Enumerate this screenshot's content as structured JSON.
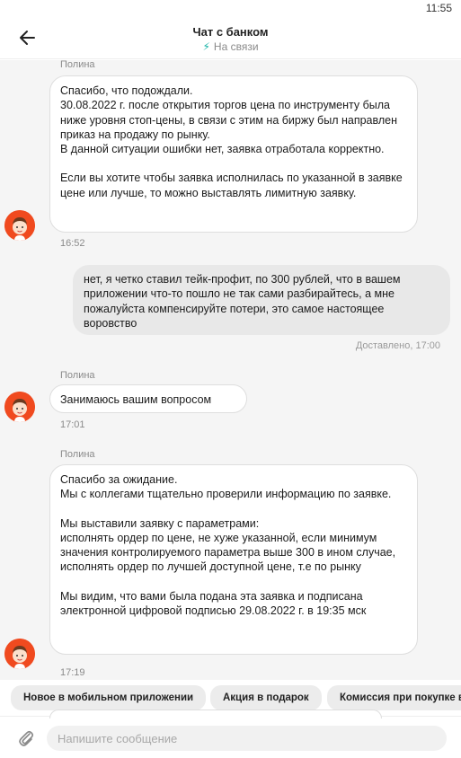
{
  "status_bar": {
    "time": "11:55"
  },
  "header": {
    "title": "Чат с банком",
    "status": "На связи",
    "status_color": "#16b3a6"
  },
  "messages": [
    {
      "direction": "incoming",
      "sender": "Полина",
      "paragraphs": [
        "Спасибо, что подождали.\n30.08.2022 г. после открытия торгов цена по инструменту была ниже уровня стоп-цены, в связи с этим на биржу был направлен приказ на продажу по рынку.\nВ данной ситуации ошибки нет, заявка отработала корректно.",
        "Если вы хотите чтобы заявка исполнилась по указанной в заявке цене или лучше, то можно выставлять лимитную заявку."
      ],
      "time": "16:52"
    },
    {
      "direction": "outgoing",
      "text": "нет, я четко ставил тейк-профит, по 300 рублей, что в вашем приложении что-то пошло не так сами разбирайтесь, а мне пожалуйста компенсируйте потери, это самое настоящее воровство",
      "status": "Доставлено, 17:00"
    },
    {
      "direction": "incoming",
      "sender": "Полина",
      "paragraphs": [
        "Занимаюсь вашим вопросом"
      ],
      "time": "17:01"
    },
    {
      "direction": "incoming",
      "sender": "Полина",
      "paragraphs": [
        "Спасибо за ожидание.\nМы с коллегами тщательно проверили информацию по заявке.",
        "Мы выставили заявку с параметрами:\nисполнять ордер по цене, не хуже указанной, если минимум значения контролируемого параметра выше 300 в ином случае, исполнять ордер по лучшей доступной цене, т.е по рынку",
        "Мы видим, что вами была подана эта заявка и подписана электронной цифровой подписью 29.08.2022 г. в 19:35 мск"
      ],
      "time": "17:19"
    }
  ],
  "quick_replies": [
    "Новое в мобильном приложении",
    "Акция в подарок",
    "Комиссия при покупке в"
  ],
  "composer": {
    "placeholder": "Напишите сообщение"
  },
  "colors": {
    "avatar_bg": "#f04a1f",
    "chat_bg": "#f5f5f5"
  },
  "icons": {
    "back": "arrow-left-icon",
    "status": "lightning-icon",
    "attach": "paperclip-icon",
    "avatar": "operator-avatar-icon"
  }
}
